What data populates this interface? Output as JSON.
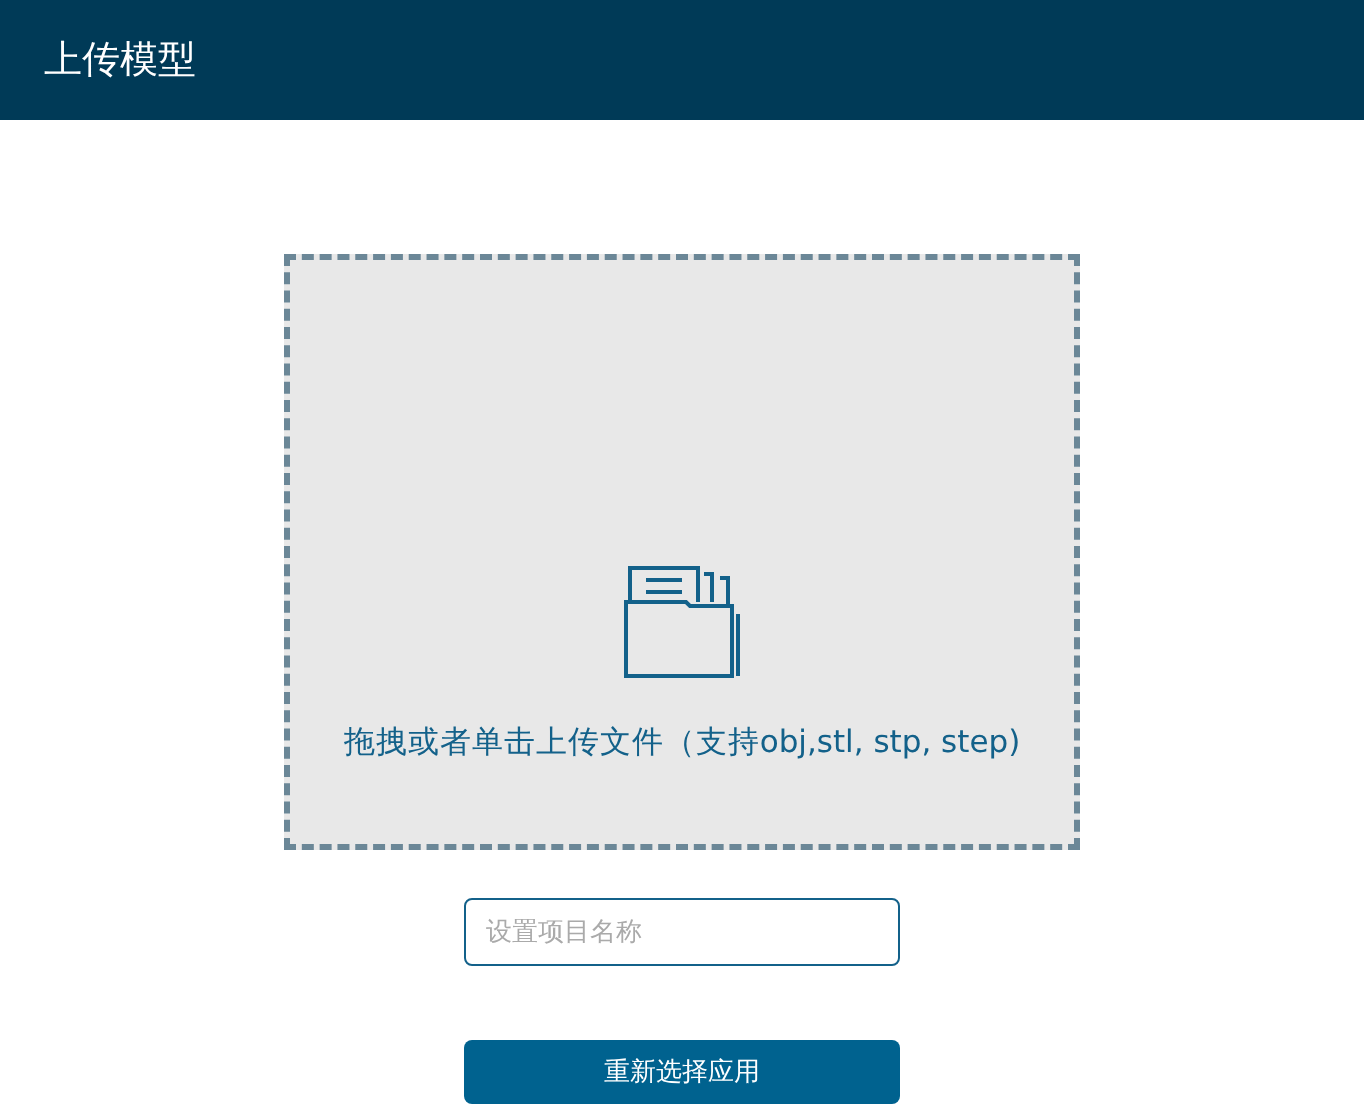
{
  "header": {
    "title": "上传模型"
  },
  "dropzone": {
    "hint": "拖拽或者单击上传文件（支持obj,stl, stp, step)"
  },
  "name_field": {
    "placeholder": "设置项目名称"
  },
  "button": {
    "label": "重新选择应用"
  }
}
